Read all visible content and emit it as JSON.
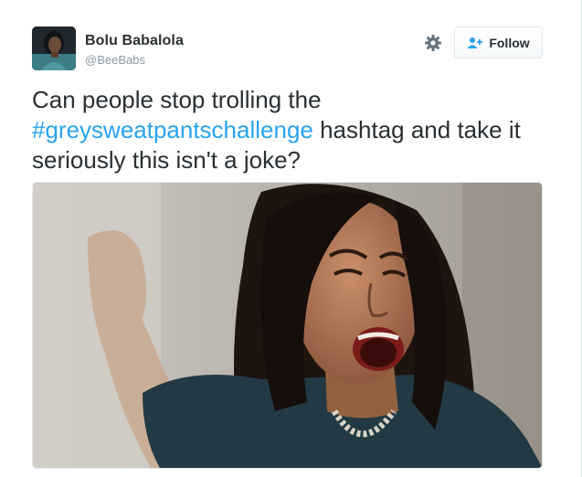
{
  "tweet": {
    "author": {
      "display_name": "Bolu Babalola",
      "handle": "@BeeBabs"
    },
    "follow_button": {
      "label": "Follow",
      "icon": "add-user-icon"
    },
    "settings_icon": "gear-icon",
    "text": {
      "before": "Can people stop trolling the ",
      "hashtag": "#greysweatpantschallenge",
      "after": " hashtag and take it seriously this isn't a joke?"
    },
    "media": {
      "kind": "photo"
    }
  },
  "colors": {
    "text": "#292f33",
    "muted": "#8899a6",
    "link": "#2aa3ef",
    "border": "#e1e8ed"
  }
}
